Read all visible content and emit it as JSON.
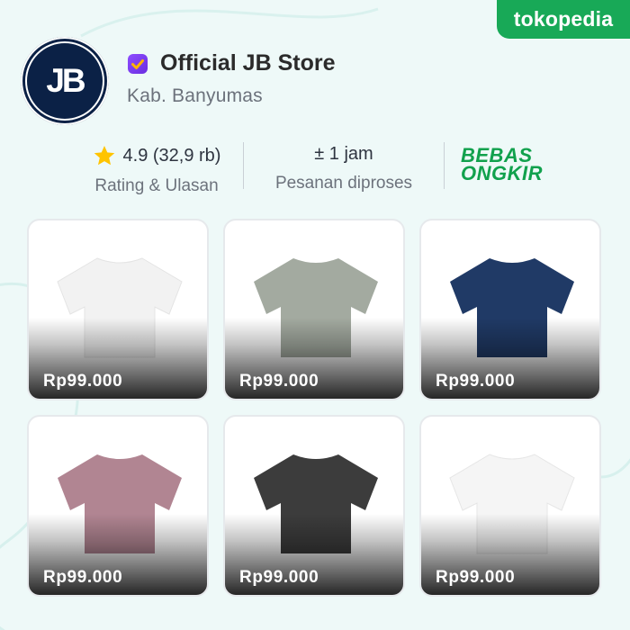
{
  "brand": {
    "name": "tokopedia",
    "color": "#18a957"
  },
  "store": {
    "logo_text": "JB",
    "name": "Official JB Store",
    "location": "Kab. Banyumas",
    "badge_icon": "official-store-badge-icon"
  },
  "stats": {
    "rating": {
      "value": "4.9 (32,9 rb)",
      "label": "Rating & Ulasan",
      "icon": "star-icon"
    },
    "processing": {
      "value": "± 1 jam",
      "label": "Pesanan diproses"
    },
    "shipping": {
      "line1": "BEBAS",
      "line2": "ONGKIR"
    }
  },
  "products": [
    {
      "price": "Rp99.000",
      "color": "#f2f2f2"
    },
    {
      "price": "Rp99.000",
      "color": "#a3aaa0"
    },
    {
      "price": "Rp99.000",
      "color": "#203a66"
    },
    {
      "price": "Rp99.000",
      "color": "#b18592"
    },
    {
      "price": "Rp99.000",
      "color": "#3c3c3c"
    },
    {
      "price": "Rp99.000",
      "color": "#f5f5f5"
    }
  ]
}
